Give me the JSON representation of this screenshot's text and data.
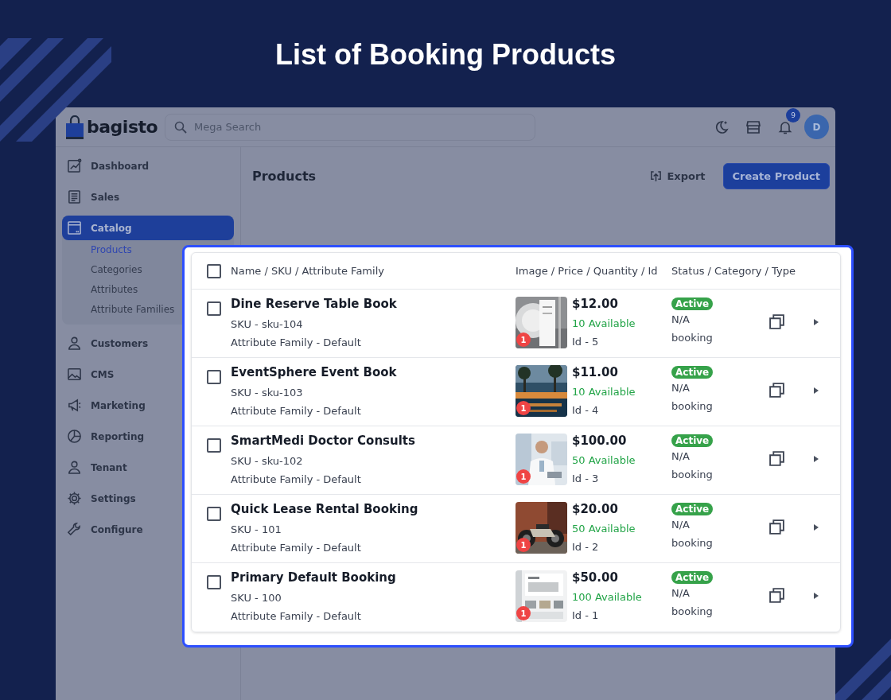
{
  "headline": "List of Booking Products",
  "header": {
    "logo": "bagisto",
    "search": {
      "placeholder": "Mega Search"
    },
    "notification_count": "9",
    "avatar": "D"
  },
  "sidebar": {
    "items": [
      {
        "label": "Dashboard",
        "selected": false
      },
      {
        "label": "Sales",
        "selected": false
      },
      {
        "label": "Catalog",
        "selected": true,
        "children": [
          {
            "label": "Products",
            "selected": true
          },
          {
            "label": "Categories",
            "selected": false
          },
          {
            "label": "Attributes",
            "selected": false
          },
          {
            "label": "Attribute Families",
            "selected": false
          }
        ]
      },
      {
        "label": "Customers",
        "selected": false
      },
      {
        "label": "CMS",
        "selected": false
      },
      {
        "label": "Marketing",
        "selected": false
      },
      {
        "label": "Reporting",
        "selected": false
      },
      {
        "label": "Tenant",
        "selected": false
      },
      {
        "label": "Settings",
        "selected": false
      },
      {
        "label": "Configure",
        "selected": false
      }
    ]
  },
  "page": {
    "title": "Products",
    "export_button": "Export",
    "create_button": "Create Product"
  },
  "table": {
    "select_all": {
      "checked": false
    },
    "columns": [
      "Name / SKU / Attribute Family",
      "Image / Price / Quantity / Id",
      "Status / Category / Type"
    ],
    "rows": [
      {
        "checked": false,
        "name": "Dine Reserve Table Book",
        "sku": "SKU - sku-104",
        "family": "Attribute Family - Default",
        "image_count": "1",
        "price": "$12.00",
        "quantity": "10 Available",
        "id": "Id - 5",
        "status": "Active",
        "category": "N/A",
        "type": "booking"
      },
      {
        "checked": false,
        "name": "EventSphere Event Book",
        "sku": "SKU - sku-103",
        "family": "Attribute Family - Default",
        "image_count": "1",
        "price": "$11.00",
        "quantity": "10 Available",
        "id": "Id - 4",
        "status": "Active",
        "category": "N/A",
        "type": "booking"
      },
      {
        "checked": false,
        "name": "SmartMedi Doctor Consults",
        "sku": "SKU - sku-102",
        "family": "Attribute Family - Default",
        "image_count": "1",
        "price": "$100.00",
        "quantity": "50 Available",
        "id": "Id - 3",
        "status": "Active",
        "category": "N/A",
        "type": "booking"
      },
      {
        "checked": false,
        "name": "Quick Lease Rental Booking",
        "sku": "SKU - 101",
        "family": "Attribute Family - Default",
        "image_count": "1",
        "price": "$20.00",
        "quantity": "50 Available",
        "id": "Id - 2",
        "status": "Active",
        "category": "N/A",
        "type": "booking"
      },
      {
        "checked": false,
        "name": "Primary Default Booking",
        "sku": "SKU - 100",
        "family": "Attribute Family - Default",
        "image_count": "1",
        "price": "$50.00",
        "quantity": "100 Available",
        "id": "Id - 1",
        "status": "Active",
        "category": "N/A",
        "type": "booking"
      }
    ]
  }
}
